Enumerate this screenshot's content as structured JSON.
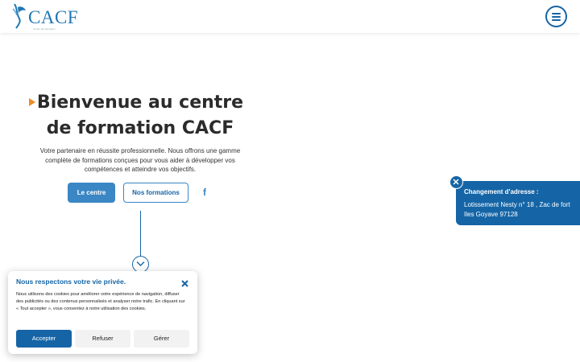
{
  "header": {
    "logo_text": "CACF",
    "logo_subtitle": "Centre de Formation",
    "menu_icon": "hamburger-menu-icon"
  },
  "hero": {
    "title_line1": "Bienvenue au centre",
    "title_line2": "de formation CACF",
    "description": "Votre partenaire en réussite professionnelle. Nous offrons une gamme complète de formations conçues pour vous aider à développer vos compétences et atteindre vos objectifs.",
    "button_primary": "Le centre",
    "button_secondary": "Nos formations",
    "social_icon": "facebook-icon",
    "scroll_icon": "chevron-down-icon"
  },
  "address_popup": {
    "title": "Changement d'adresse :",
    "text": "Lotissement Nesty n° 18 , Zac de fort Iles Goyave 97128",
    "close_icon": "close-icon"
  },
  "cookie_banner": {
    "title": "Nous respectons votre vie privée.",
    "text": "Nous utilisons des cookies pour améliorer votre expérience de navigation, diffuser des publicités ou des contenus personnalisés et analyser notre trafic. En cliquant sur « Tout accepter », vous consentez à notre utilisation des cookies.",
    "accept_label": "Accepter",
    "refuse_label": "Refuser",
    "manage_label": "Gérer",
    "close_icon": "close-icon"
  },
  "colors": {
    "primary": "#1565a6",
    "button": "#3b86c4",
    "accent": "#f08a24"
  }
}
